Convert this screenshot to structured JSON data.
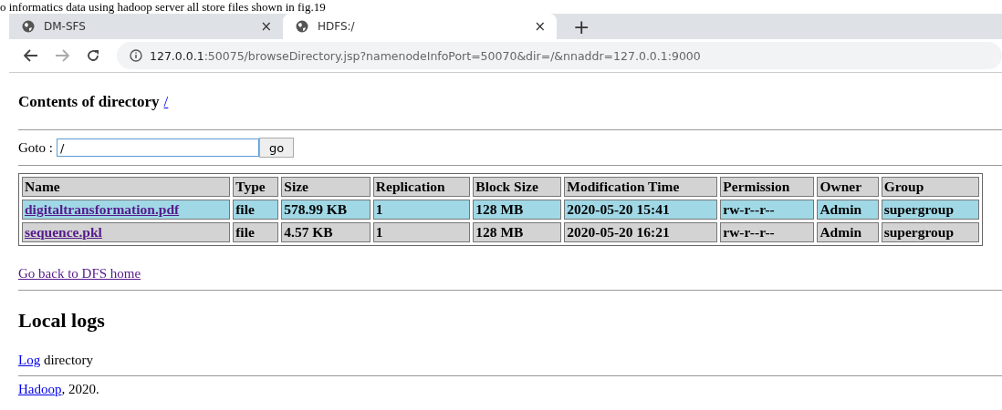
{
  "caption": "o informatics data using hadoop server all store files shown in fig.19",
  "tabs": [
    {
      "title": "DM-SFS",
      "selected": false,
      "close": "×"
    },
    {
      "title": "HDFS:/",
      "selected": true,
      "close": "×"
    }
  ],
  "new_tab": "+",
  "address_bar": {
    "host": "127.0.0.1",
    "rest": ":50075/browseDirectory.jsp?namenodeInfoPort=50070&dir=/&nnaddr=127.0.0.1:9000"
  },
  "heading": {
    "text": "Contents of directory",
    "link": "/"
  },
  "goto": {
    "label": "Goto :",
    "value": "/",
    "button": "go"
  },
  "table": {
    "columns": [
      "Name",
      "Type",
      "Size",
      "Replication",
      "Block Size",
      "Modification Time",
      "Permission",
      "Owner",
      "Group"
    ],
    "rows": [
      {
        "selected": true,
        "cells": [
          "digitaltransformation.pdf",
          "file",
          "578.99 KB",
          "1",
          "128 MB",
          "2020-05-20 15:41",
          "rw-r--r--",
          "Admin",
          "supergroup"
        ]
      },
      {
        "selected": false,
        "cells": [
          "sequence.pkl",
          "file",
          "4.57 KB",
          "1",
          "128 MB",
          "2020-05-20 16:21",
          "rw-r--r--",
          "Admin",
          "supergroup"
        ]
      }
    ]
  },
  "back_link": "Go back to DFS home",
  "local_logs": {
    "title": "Local logs",
    "link": "Log",
    "text": "directory"
  },
  "footer": {
    "link": "Hadoop",
    "text": ", 2020."
  }
}
